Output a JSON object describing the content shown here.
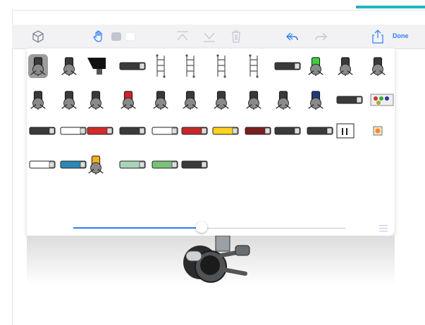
{
  "toolbar": {
    "done_label": "Done",
    "icons": [
      "cube-icon",
      "hand-icon",
      "rect-icon",
      "rect-icon",
      "move-top-icon",
      "move-bottom-icon",
      "trash-icon",
      "undo-icon",
      "redo-icon",
      "share-icon"
    ]
  },
  "library": {
    "selected_index": 0,
    "rows": [
      [
        "camera-crane",
        "light-stand",
        "softbox",
        "camera-cart",
        "straight-track",
        "ladder-track",
        "curved-track",
        "curved-track-2",
        "camera-cart-2",
        "green-rail",
        "jib-arm",
        "tripod-stand"
      ],
      [
        "camera-pedestal",
        "dolly-camera",
        "steadicam",
        "camera-red",
        "camera-tripod",
        "handheld-camera",
        "camera-stabilizer",
        "camera-head",
        "camera-gimbal",
        "camera-blue",
        "slim-rig",
        "prop-pack"
      ],
      [
        "cable",
        "box-truck",
        "red-truck",
        "long-truck",
        "trailer",
        "fire-truck",
        "yellow-bus",
        "semi-truck",
        "tanker",
        "grey-van",
        "restroom",
        "spot-light"
      ],
      [
        "trailer-2",
        "limo",
        "operator-top",
        "small-van",
        "green-car",
        "wheel-track"
      ]
    ]
  },
  "zoom_slider": {
    "value": 0.47
  },
  "colors": {
    "accent": "#1fb4c0",
    "brand_blue": "#2e7df6",
    "icon_grey": "#b9bec6"
  }
}
